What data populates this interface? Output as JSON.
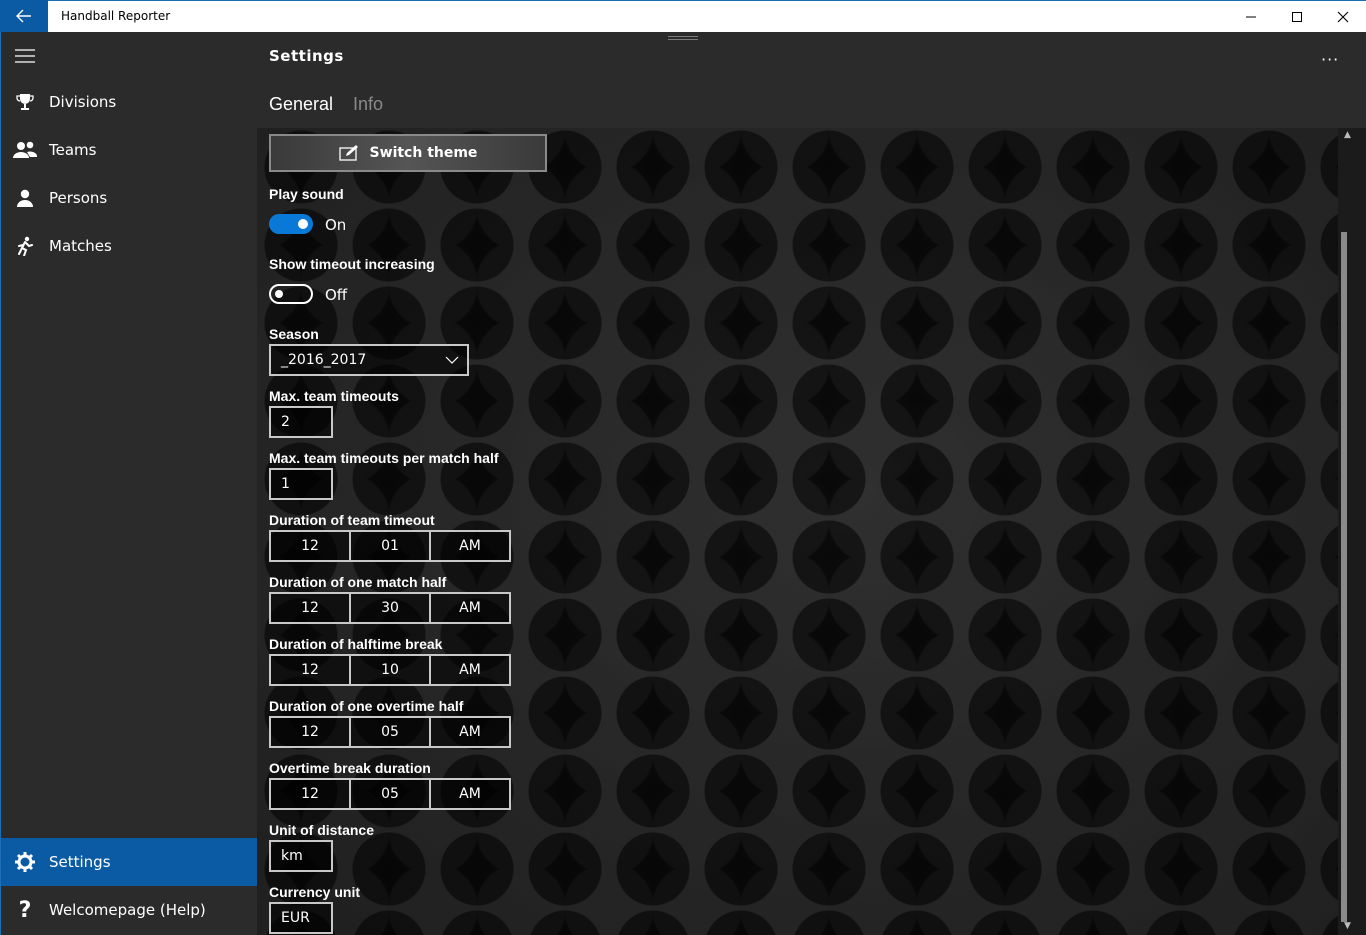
{
  "app": {
    "title": "Handball Reporter"
  },
  "window": {
    "minimize_icon": "minimize-icon",
    "maximize_icon": "maximize-icon",
    "close_icon": "close-icon"
  },
  "nav": {
    "items": [
      {
        "label": "Divisions",
        "icon": "trophy-icon"
      },
      {
        "label": "Teams",
        "icon": "people-icon"
      },
      {
        "label": "Persons",
        "icon": "person-icon"
      },
      {
        "label": "Matches",
        "icon": "runner-icon"
      }
    ],
    "footer": [
      {
        "label": "Settings",
        "icon": "gear-icon",
        "selected": true
      },
      {
        "label": "Welcomepage (Help)",
        "icon": "help-icon"
      }
    ]
  },
  "header": {
    "title": "Settings",
    "more": "···",
    "tabs": [
      {
        "label": "General",
        "active": true
      },
      {
        "label": "Info",
        "active": false
      }
    ]
  },
  "settings": {
    "switch_theme": "Switch theme",
    "play_sound": {
      "label": "Play sound",
      "state": "On"
    },
    "show_timeout": {
      "label": "Show timeout increasing",
      "state": "Off"
    },
    "season": {
      "label": "Season",
      "value": "_2016_2017"
    },
    "max_team_timeouts": {
      "label": "Max. team timeouts",
      "value": "2"
    },
    "max_timeouts_half": {
      "label": "Max. team timeouts per match half",
      "value": "1"
    },
    "duration_team_timeout": {
      "label": "Duration of team timeout",
      "h": "12",
      "m": "01",
      "p": "AM"
    },
    "duration_match_half": {
      "label": "Duration of one match half",
      "h": "12",
      "m": "30",
      "p": "AM"
    },
    "duration_halftime_break": {
      "label": "Duration of halftime break",
      "h": "12",
      "m": "10",
      "p": "AM"
    },
    "duration_overtime_half": {
      "label": "Duration of one overtime half",
      "h": "12",
      "m": "05",
      "p": "AM"
    },
    "overtime_break": {
      "label": "Overtime break duration",
      "h": "12",
      "m": "05",
      "p": "AM"
    },
    "unit_distance": {
      "label": "Unit of distance",
      "value": "km"
    },
    "currency_unit": {
      "label": "Currency unit",
      "value": "EUR"
    }
  },
  "colors": {
    "accent": "#0a5ba3",
    "toggle_on": "#0a78d7",
    "pane": "#2b2b2b"
  }
}
